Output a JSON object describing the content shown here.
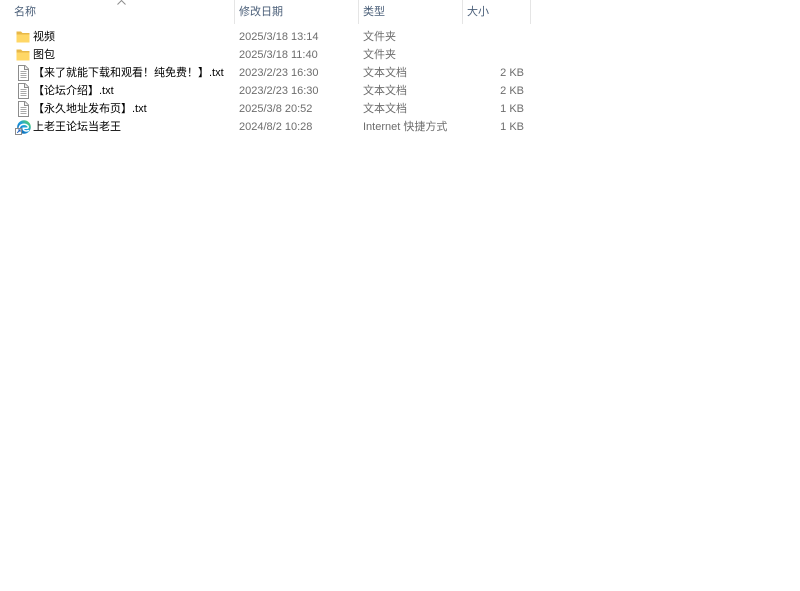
{
  "header": {
    "columns": [
      {
        "label": "名称",
        "sort_icon": "chevron-up-icon"
      },
      {
        "label": "修改日期"
      },
      {
        "label": "类型"
      },
      {
        "label": "大小"
      }
    ]
  },
  "files": [
    {
      "icon": "folder-icon",
      "name": "视频",
      "modified": "2025/3/18 13:14",
      "type": "文件夹"
    },
    {
      "icon": "folder-icon",
      "name": "图包",
      "modified": "2025/3/18 11:40",
      "type": "文件夹"
    },
    {
      "icon": "text-document-icon",
      "name": "【来了就能下载和观看！纯免费！】.txt",
      "modified": "2023/2/23 16:30",
      "type": "文本文档",
      "size": "2 KB"
    },
    {
      "icon": "text-document-icon",
      "name": "【论坛介绍】.txt",
      "modified": "2023/2/23 16:30",
      "type": "文本文档",
      "size": "2 KB"
    },
    {
      "icon": "text-document-icon",
      "name": "【永久地址发布页】.txt",
      "modified": "2025/3/8 20:52",
      "type": "文本文档",
      "size": "1 KB"
    },
    {
      "icon": "internet-shortcut-icon",
      "name": "上老王论坛当老王",
      "modified": "2024/8/2 10:28",
      "type": "Internet 快捷方式",
      "size": "1 KB"
    }
  ],
  "colors": {
    "background": "#ffffff",
    "primary_text": "#000000",
    "secondary_text": "#6d6d6d",
    "header_text": "#4c607a",
    "column_divider": "#e5e5e5",
    "folder": "#ffd766"
  }
}
